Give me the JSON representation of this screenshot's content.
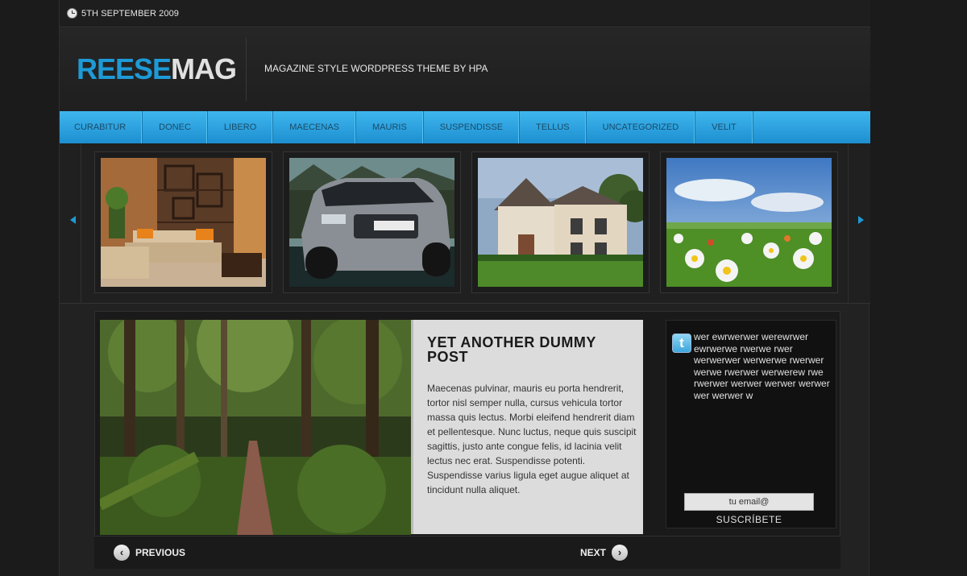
{
  "topbar": {
    "date": "5TH SEPTEMBER 2009",
    "icon": "clock-icon"
  },
  "header": {
    "logo_part1": "REESE",
    "logo_part2": "MAG",
    "tagline": "MAGAZINE STYLE WORDPRESS THEME BY HPA",
    "brand_color": "#1e9ad6"
  },
  "nav": {
    "items": [
      "CURABITUR",
      "DONEC",
      "LIBERO",
      "MAECENAS",
      "MAURIS",
      "SUSPENDISSE",
      "TELLUS",
      "UNCATEGORIZED",
      "VELIT"
    ]
  },
  "slider": {
    "thumbnails": [
      "living-room",
      "car",
      "house",
      "flowers"
    ],
    "prev_icon": "triangle-left-icon",
    "next_icon": "triangle-right-icon"
  },
  "featured": {
    "title": "YET ANOTHER DUMMY POST",
    "body": "Maecenas pulvinar, mauris eu porta hendrerit, tortor nisl semper nulla, cursus vehicula tortor massa quis lectus. Morbi eleifend hendrerit diam et pellentesque. Nunc luctus, neque quis suscipit sagittis, justo ante congue felis, id lacinia velit lectus nec erat. Suspendisse potenti. Suspendisse varius ligula eget augue aliquet at tincidunt nulla aliquet."
  },
  "twitter": {
    "icon": "twitter-bird-icon",
    "tweet": "wer ewrwerwer werewrwer ewrwerwe rwerwe rwer werwerwer werwerwe rwerwer werwe rwerwer werwerew rwe rwerwer werwer werwer werwer wer werwer w",
    "email_placeholder": "tu email@",
    "subscribe_label": "SUSCRÍBETE"
  },
  "pager": {
    "previous_label": "PREVIOUS",
    "next_label": "NEXT"
  }
}
